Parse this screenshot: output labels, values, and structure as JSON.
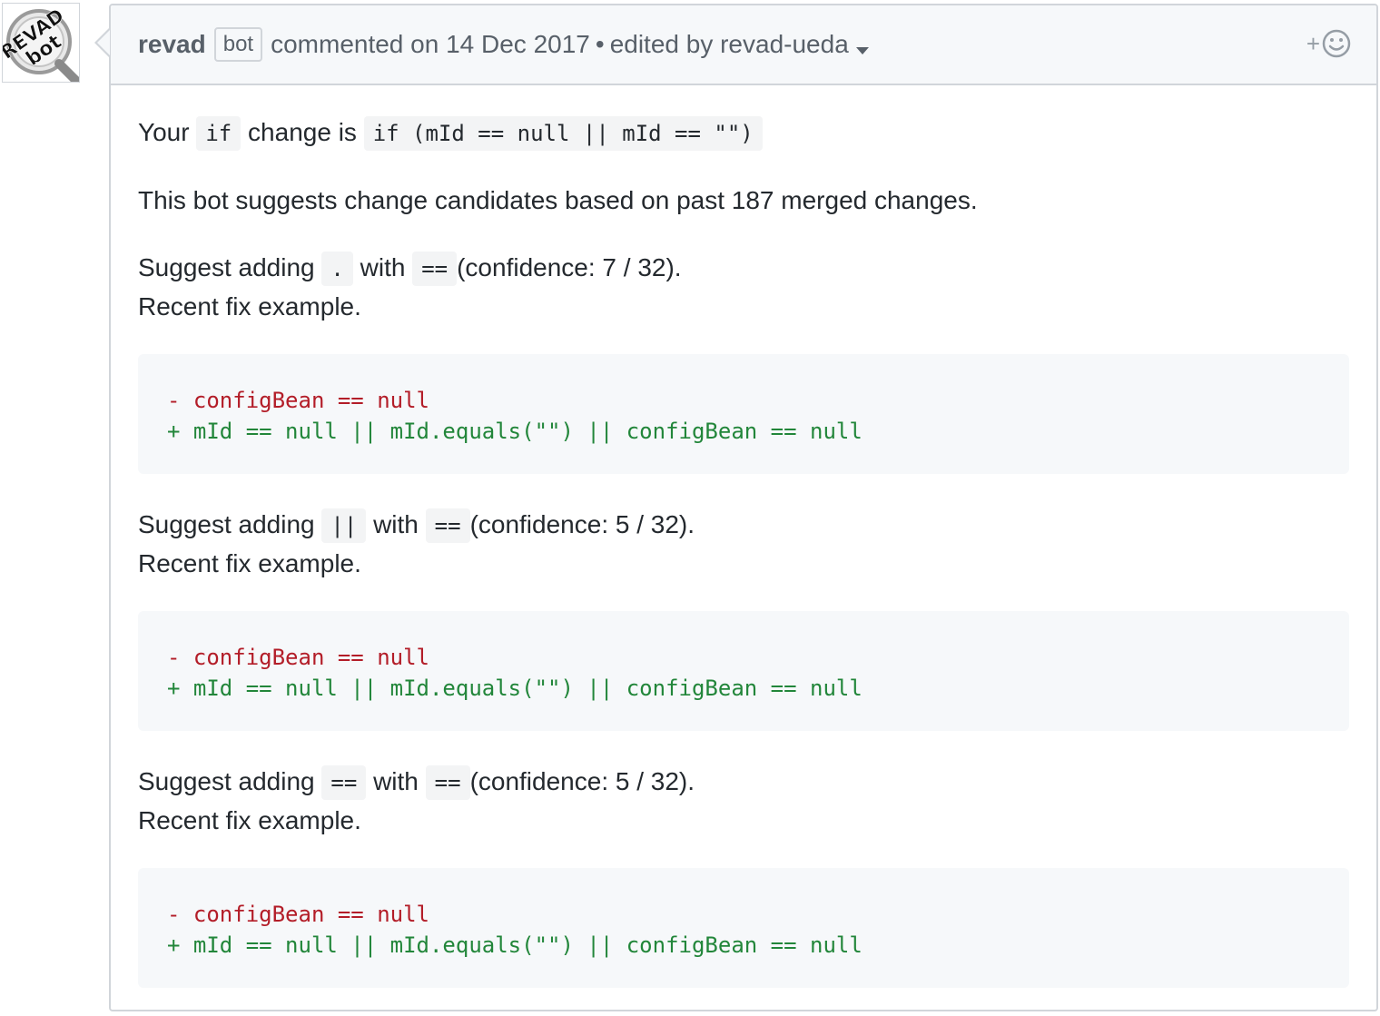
{
  "comment": {
    "author": "revad",
    "author_label": "bot",
    "commented_text": "commented on 14 Dec 2017",
    "separator": "•",
    "edited_text": "edited by revad-ueda",
    "reaction_plus": "+"
  },
  "avatar": {
    "line1": "REVAD",
    "line2": "bot"
  },
  "body": {
    "intro": {
      "prefix": "Your",
      "code1": "if",
      "middle": "change is",
      "code2": "if (mId == null || mId == \"\")"
    },
    "summary": "This bot suggests change candidates based on past 187 merged changes.",
    "suggestions": [
      {
        "prefix": "Suggest adding",
        "code_add": ".",
        "with": "with",
        "code_with": "==",
        "confidence": "(confidence: 7 / 32).",
        "recent": "Recent fix example.",
        "del_line": "- configBean == null",
        "add_line": "+ mId == null || mId.equals(\"\") || configBean == null"
      },
      {
        "prefix": "Suggest adding",
        "code_add": "||",
        "with": "with",
        "code_with": "==",
        "confidence": "(confidence: 5 / 32).",
        "recent": "Recent fix example.",
        "del_line": "- configBean == null",
        "add_line": "+ mId == null || mId.equals(\"\") || configBean == null"
      },
      {
        "prefix": "Suggest adding",
        "code_add": "==",
        "with": "with",
        "code_with": "==",
        "confidence": "(confidence: 5 / 32).",
        "recent": "Recent fix example.",
        "del_line": "- configBean == null",
        "add_line": "+ mId == null || mId.equals(\"\") || configBean == null"
      }
    ]
  },
  "colors": {
    "deleted": "#b31d28",
    "added": "#22863a",
    "border": "#d1d5da",
    "header_bg": "#f6f8fa"
  },
  "icons": {
    "avatar": "revad-bot-logo",
    "reaction": "smiley-icon",
    "dropdown": "chevron-down-icon"
  }
}
